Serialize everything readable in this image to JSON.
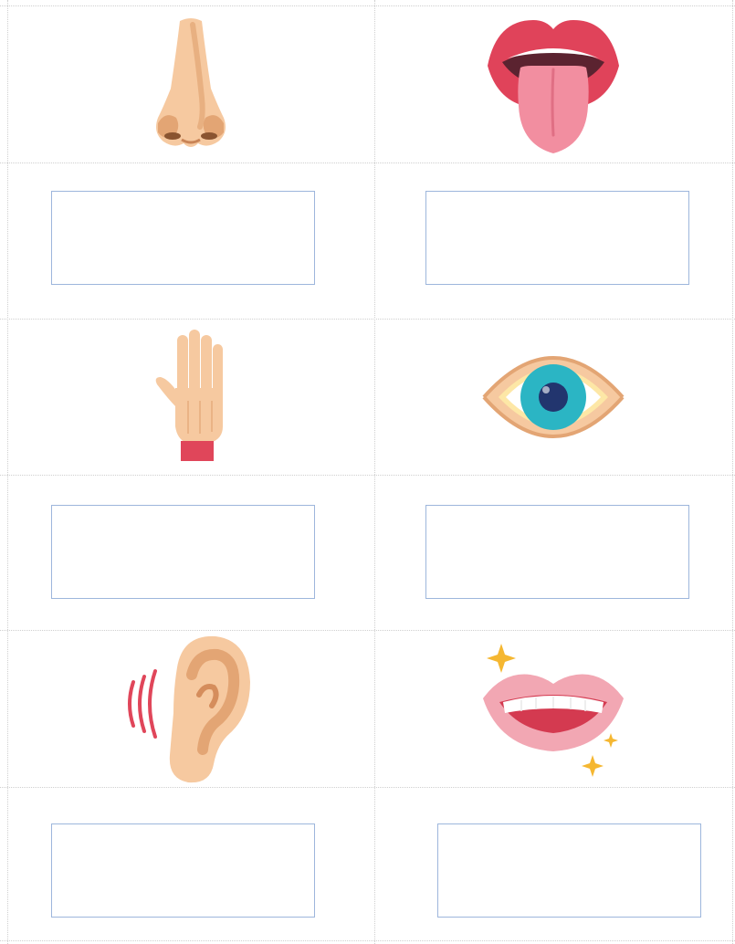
{
  "worksheet": {
    "cards": [
      {
        "icon": "nose-icon",
        "answer": ""
      },
      {
        "icon": "tongue-icon",
        "answer": ""
      },
      {
        "icon": "hand-icon",
        "answer": ""
      },
      {
        "icon": "eye-icon",
        "answer": ""
      },
      {
        "icon": "ear-icon",
        "answer": ""
      },
      {
        "icon": "smiling-mouth-icon",
        "answer": ""
      }
    ]
  },
  "colors": {
    "skin": "#f6c9a0",
    "skin_shadow": "#e3a574",
    "lip_red": "#e0435a",
    "tongue_pink": "#f28ea0",
    "iris_teal": "#2bb5c4",
    "pupil_navy": "#22356e",
    "cuff_red": "#e0465a",
    "sparkle_gold": "#f5b731",
    "box_border": "#9db6dc",
    "grid_dotted": "#cfcfcf"
  }
}
